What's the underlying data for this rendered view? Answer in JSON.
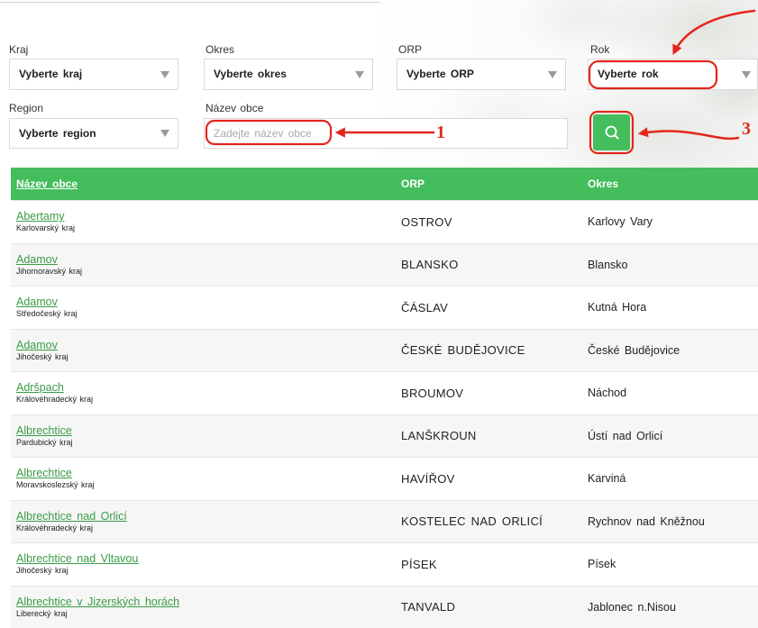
{
  "filters": {
    "kraj": {
      "label": "Kraj",
      "value": "Vyberte kraj"
    },
    "okres": {
      "label": "Okres",
      "value": "Vyberte okres"
    },
    "orp": {
      "label": "ORP",
      "value": "Vyberte ORP"
    },
    "rok": {
      "label": "Rok",
      "value": "Vyberte rok"
    },
    "region": {
      "label": "Region",
      "value": "Vyberte region"
    },
    "nazev_obce": {
      "label": "Název obce",
      "placeholder": "Zadejte název obce"
    }
  },
  "annotations": {
    "step1": "1",
    "step3": "3"
  },
  "table": {
    "columns": [
      "Název obce",
      "ORP",
      "Okres"
    ],
    "rows": [
      {
        "obec": "Abertamy",
        "kraj": "Karlovarský kraj",
        "orp": "OSTROV",
        "okres": "Karlovy Vary"
      },
      {
        "obec": "Adamov",
        "kraj": "Jihomoravský kraj",
        "orp": "BLANSKO",
        "okres": "Blansko"
      },
      {
        "obec": "Adamov",
        "kraj": "Středočeský kraj",
        "orp": "ČÁSLAV",
        "okres": "Kutná Hora"
      },
      {
        "obec": "Adamov",
        "kraj": "Jihočeský kraj",
        "orp": "ČESKÉ BUDĚJOVICE",
        "okres": "České Budějovice"
      },
      {
        "obec": "Adršpach",
        "kraj": "Královéhradecký kraj",
        "orp": "BROUMOV",
        "okres": "Náchod"
      },
      {
        "obec": "Albrechtice",
        "kraj": "Pardubický kraj",
        "orp": "LANŠKROUN",
        "okres": "Ústí nad Orlicí"
      },
      {
        "obec": "Albrechtice",
        "kraj": "Moravskoslezský kraj",
        "orp": "HAVÍŘOV",
        "okres": "Karviná"
      },
      {
        "obec": "Albrechtice nad Orlicí",
        "kraj": "Královéhradecký kraj",
        "orp": "KOSTELEC NAD ORLICÍ",
        "okres": "Rychnov nad Kněžnou"
      },
      {
        "obec": "Albrechtice nad Vltavou",
        "kraj": "Jihočeský kraj",
        "orp": "PÍSEK",
        "okres": "Písek"
      },
      {
        "obec": "Albrechtice v Jizerských horách",
        "kraj": "Liberecký kraj",
        "orp": "TANVALD",
        "okres": "Jablonec n.Nisou"
      }
    ]
  },
  "icons": {
    "search": "search-icon",
    "dropdown": "triangle-down-icon"
  },
  "colors": {
    "accent": "#44bd5c",
    "link": "#3a9c46",
    "annotation": "#e3261c"
  }
}
